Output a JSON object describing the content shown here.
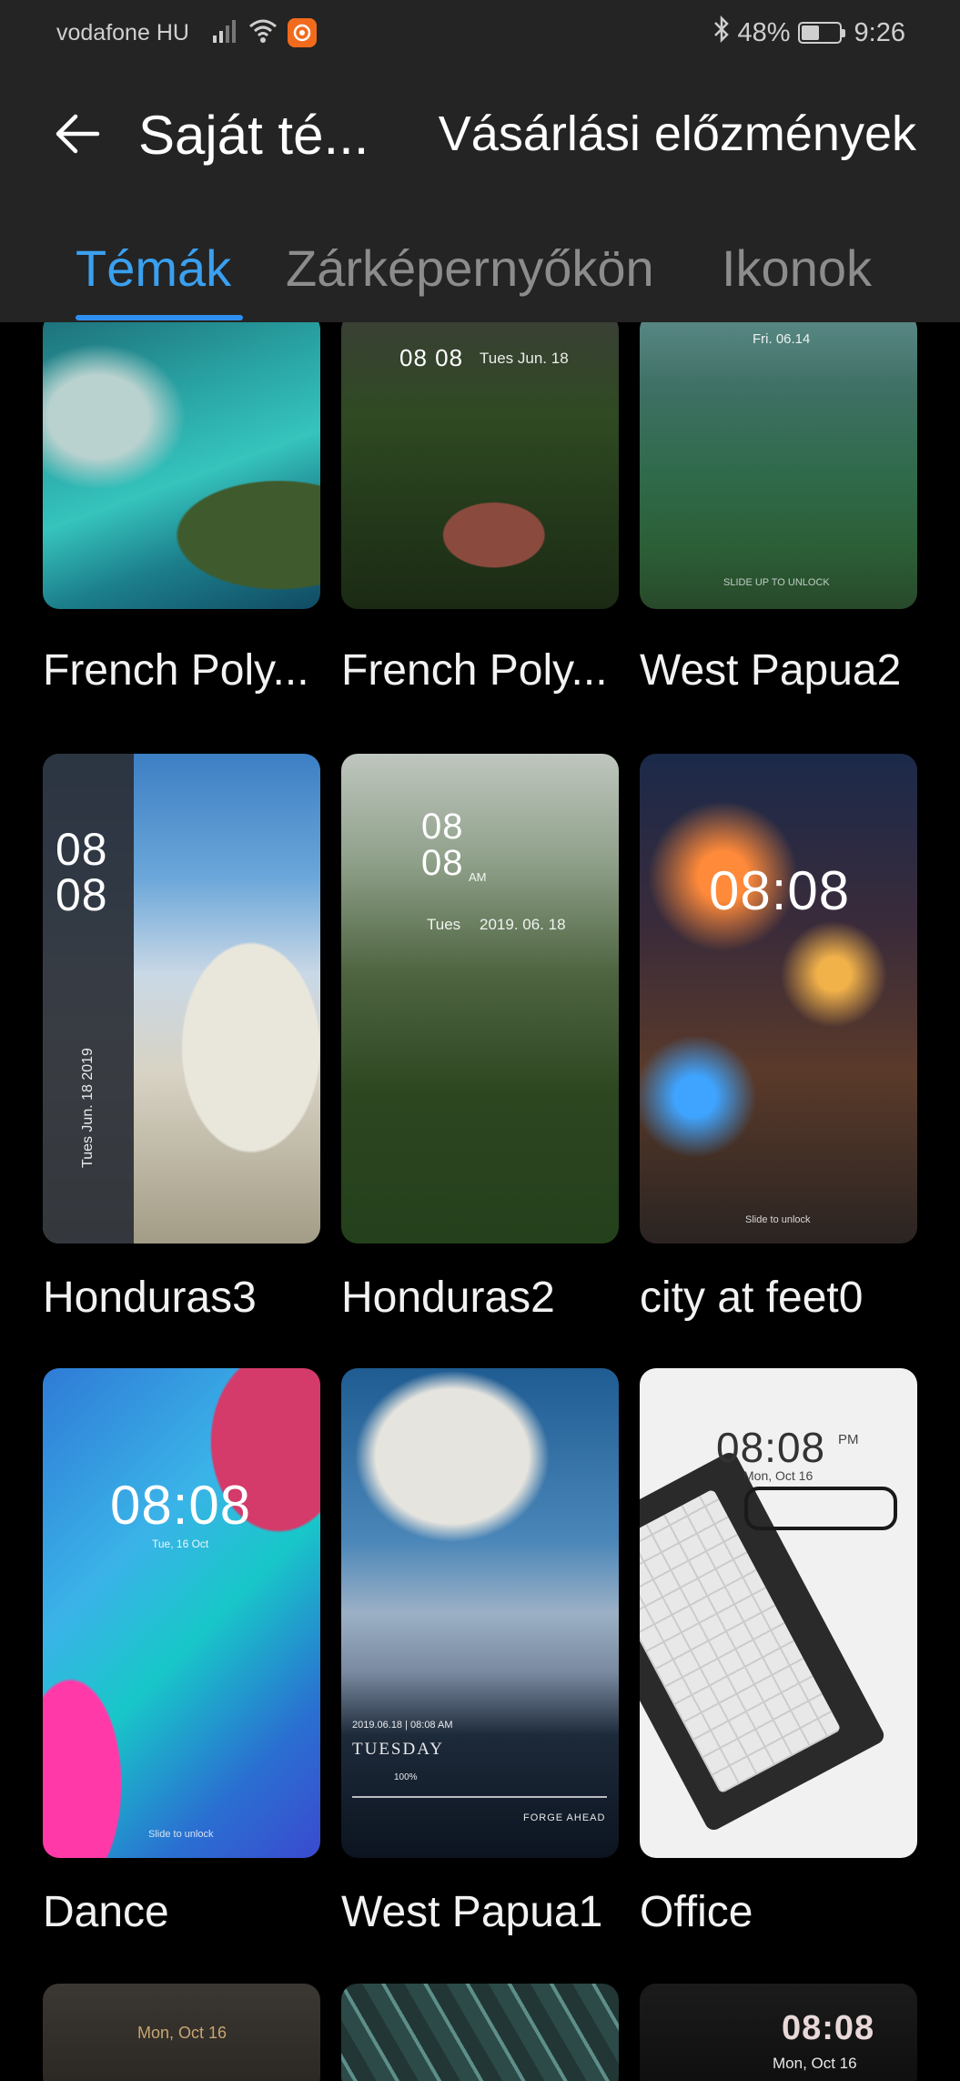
{
  "status_bar": {
    "carrier": "vodafone HU",
    "battery_percent": "48%",
    "battery_level": 0.48,
    "time": "9:26"
  },
  "header": {
    "back_icon": "arrow-left-icon",
    "title": "Saját té...",
    "history_link": "Vásárlási előzmények"
  },
  "tabs": [
    {
      "label": "Témák",
      "active": true
    },
    {
      "label": "Zárképernyőkön",
      "active": false
    },
    {
      "label": "Ikonok",
      "active": false
    }
  ],
  "themes": [
    {
      "name": "French Poly..."
    },
    {
      "name": "French Poly...",
      "preview_time": "08 08",
      "preview_date": "Tues Jun. 18"
    },
    {
      "name": "West Papua2",
      "preview_date": "Fri. 06.14",
      "preview_hint": "SLIDE UP TO UNLOCK"
    },
    {
      "name": "Honduras3",
      "preview_time_top": "08",
      "preview_time_bottom": "08",
      "preview_date": "Tues   Jun. 18   2019"
    },
    {
      "name": "Honduras2",
      "preview_time_top": "08",
      "preview_time_bottom": "08",
      "preview_ampm": "AM",
      "preview_day": "Tues",
      "preview_date": "2019. 06. 18"
    },
    {
      "name": "city at feet0",
      "preview_time": "08:08",
      "preview_hint": "Slide to unlock"
    },
    {
      "name": "Dance",
      "preview_time": "08:08",
      "preview_date": "Tue, 16 Oct",
      "preview_hint": "Slide to unlock"
    },
    {
      "name": "West Papua1",
      "preview_date": "2019.06.18 | 08:08 AM",
      "preview_day": "TUESDAY",
      "preview_percent": "100%",
      "preview_tagline": "FORGE AHEAD"
    },
    {
      "name": "Office",
      "preview_time": "08:08",
      "preview_ampm": "PM",
      "preview_date": "Mon, Oct 16"
    },
    {
      "name": "",
      "preview_date": "Mon, Oct 16"
    },
    {
      "name": ""
    },
    {
      "name": "",
      "preview_time": "08:08",
      "preview_date": "Mon, Oct 16"
    }
  ]
}
